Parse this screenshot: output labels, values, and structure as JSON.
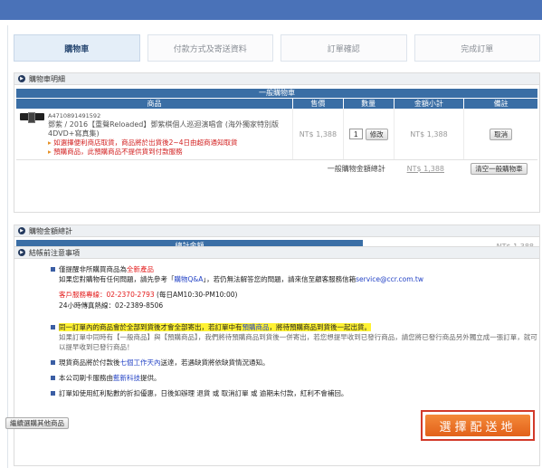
{
  "steps": [
    {
      "label": "購物車"
    },
    {
      "label": "付款方式及寄送資料"
    },
    {
      "label": "訂單確認"
    },
    {
      "label": "完成訂單"
    }
  ],
  "cart": {
    "section_title": "購物車明細",
    "group_title": "一般購物車",
    "columns": {
      "product": "商品",
      "price": "售價",
      "qty": "數量",
      "subtotal": "金額小計",
      "note": "備註"
    },
    "item": {
      "code": "A4710891491592",
      "name": "鄧紫 / 2016【重聲Reloaded】鄧紫棋個人巡迴演唱會 (海外獨家特別版4DVD+寫真集)",
      "warning1": "如選擇便利商店取貨，商品將於出貨後2~4日由超商通知取貨",
      "warning2": "預購商品，此預購商品不提供貨到付款服務",
      "price": "NT$ 1,388",
      "qty": "1",
      "update_label": "修改",
      "subtotal": "NT$ 1,388",
      "cancel_label": "取消"
    },
    "total_label": "一般購物金額總計",
    "total_value": "NT$ 1,388",
    "clear_label": "清空一般購物車"
  },
  "summary": {
    "section_title": "購物金額總計",
    "label": "總計金額",
    "value": "NT$ 1,388"
  },
  "notes": {
    "section_title": "結帳前注意事項",
    "n1_a": "僅提醒非所購買商品為",
    "n1_link": "全新產品",
    "n1_b": "如果您對購物有任何問題，請先參考「",
    "n1_faq": "購物Q&A",
    "n1_c": "」，若仍無法解答您的問題，請來信至顧客服務信箱",
    "n1_email": "service@ccr.com.tw",
    "hotline_label": "客戶服務專線：02-2370-2793",
    "hotline_hours": "(每日AM10:30-PM10:00)",
    "fax": "24小時傳真熱線：02-2389-8506",
    "n2_a": "同一訂單內的商品會於全部到貨後才會全部寄出，若訂單中有",
    "n2_link": "預購商品",
    "n2_b": "，將待預購商品到貨後一起出貨。",
    "n2_c": "如果訂單中同時有【一般商品】與【預購商品】，我們將待預購商品到貨後一併寄出，若您想提早收到已發行商品，請您將已發行商品另外獨立成一張訂單，就可以提早收到已發行商品！",
    "n3_a": "現貨商品將於付款後",
    "n3_link": "七個工作天內",
    "n3_b": "送達，若遇缺貨將依缺貨情況通知。",
    "n4_a": "本公司刷卡服務由",
    "n4_link": "藍新科技",
    "n4_b": "提供。",
    "n5": "訂單如使用紅利點數的折扣優惠，日後如辦理 退貨 或 取消訂單 或 逾期未付款，紅利不會補回。"
  },
  "footer": {
    "continue_label": "繼續選購其他商品",
    "next_label": "選擇配送地"
  }
}
